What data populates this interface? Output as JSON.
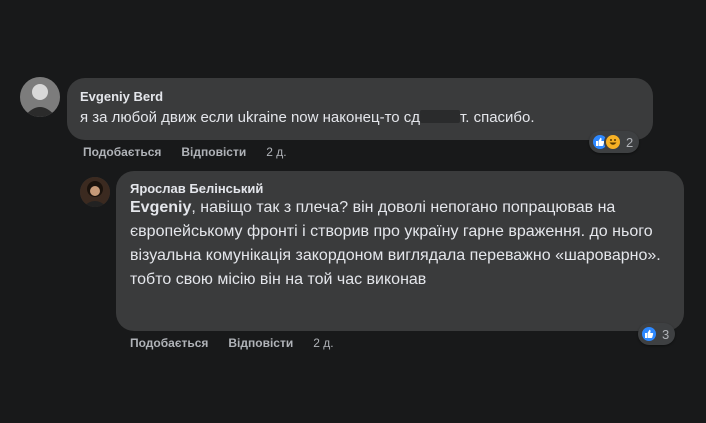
{
  "comments": [
    {
      "author": "Evgeniy Berd",
      "text_before": "я за любой движ если ukraine now наконец-то сд",
      "text_after": "т. спасибо.",
      "actions": {
        "like": "Подобається",
        "reply": "Відповісти",
        "time": "2 д."
      },
      "reactions": {
        "icons": [
          "like-icon",
          "haha-icon"
        ],
        "count": "2"
      }
    },
    {
      "author": "Ярослав Белінський",
      "mention": "Evgeniy",
      "text": ", навіщо так з плеча? він доволі непогано попрацював на європейському фронті і створив про україну гарне враження. до нього візуальна комунікація закордоном виглядала переважно «шароварно». тобто свою місію він на той час виконав",
      "actions": {
        "like": "Подобається",
        "reply": "Відповісти",
        "time": "2 д."
      },
      "reactions": {
        "icons": [
          "like-icon"
        ],
        "count": "3"
      }
    }
  ],
  "colors": {
    "background": "#18191a",
    "bubble": "#3a3b3c",
    "text": "#e4e6eb",
    "secondary": "#b0b3b8",
    "like_blue": "#2d88ff"
  }
}
